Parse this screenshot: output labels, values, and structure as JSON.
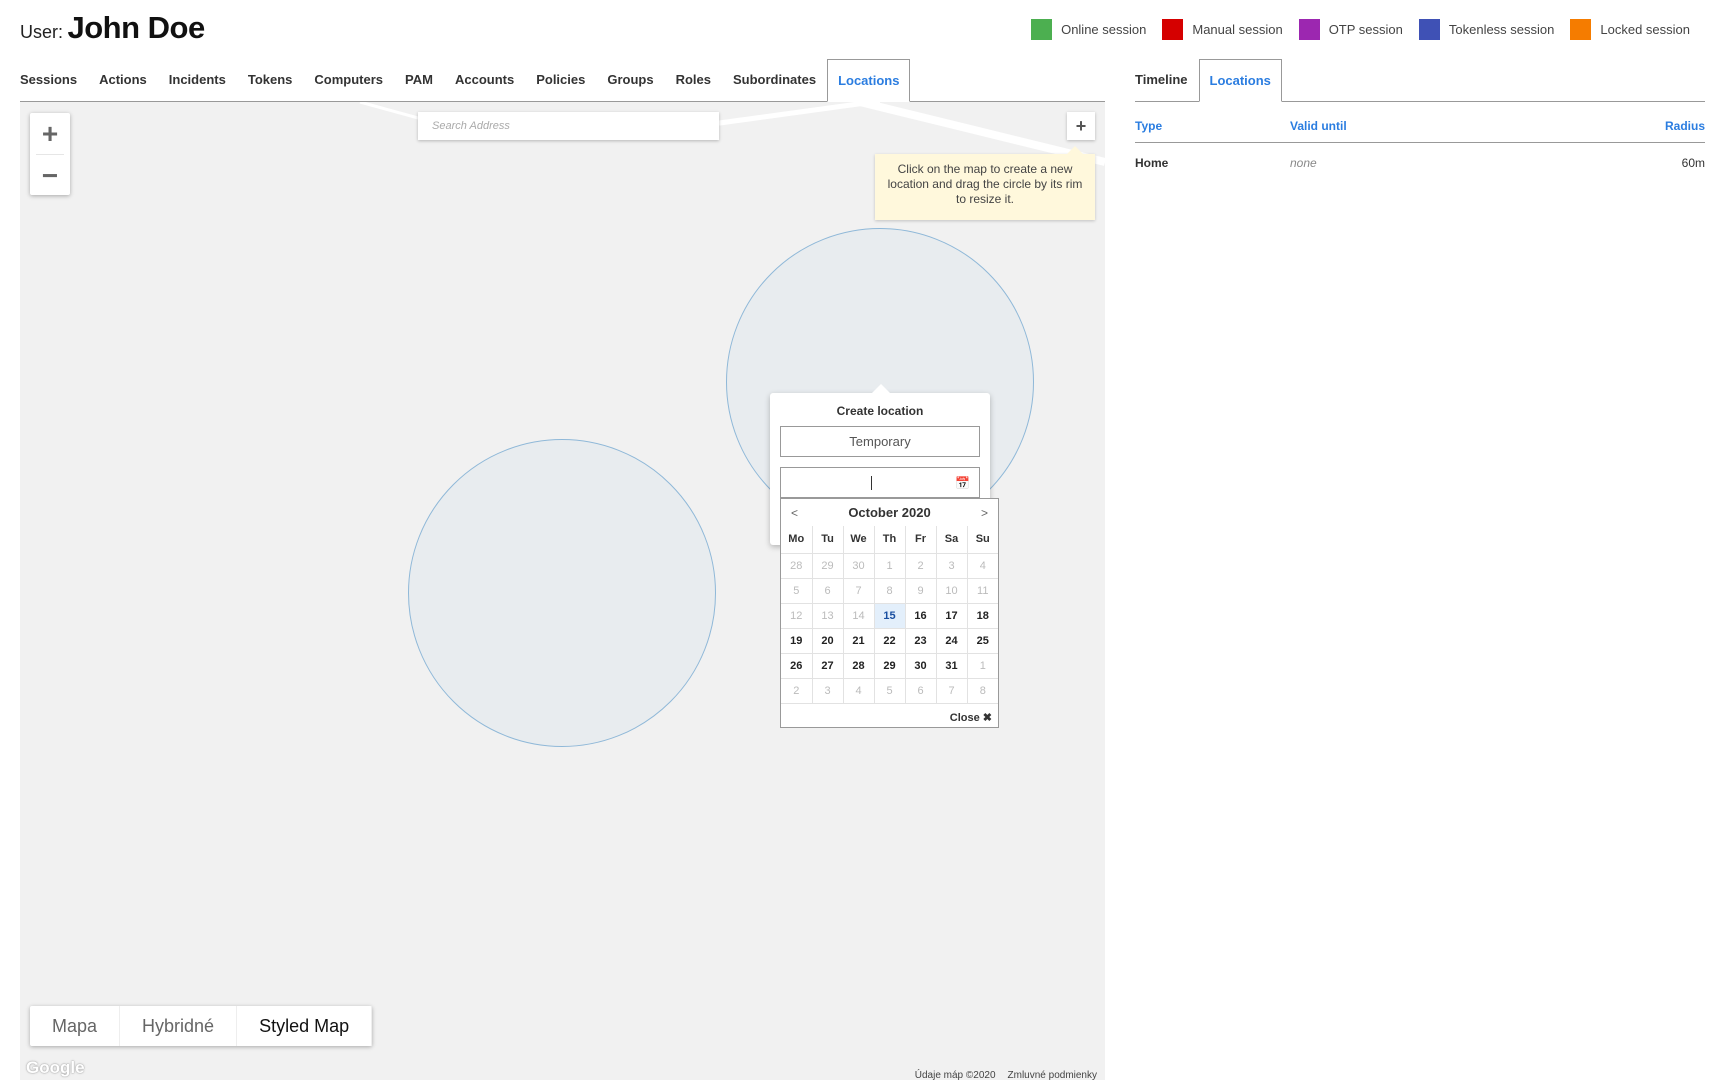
{
  "header": {
    "user_label": "User:",
    "user_name": "John Doe"
  },
  "legend": [
    {
      "label": "Online session",
      "color": "#4caf50"
    },
    {
      "label": "Manual session",
      "color": "#d50000"
    },
    {
      "label": "OTP session",
      "color": "#9c27b0"
    },
    {
      "label": "Tokenless session",
      "color": "#3f51b5"
    },
    {
      "label": "Locked session",
      "color": "#f57c00"
    }
  ],
  "main_tabs": [
    "Sessions",
    "Actions",
    "Incidents",
    "Tokens",
    "Computers",
    "PAM",
    "Accounts",
    "Policies",
    "Groups",
    "Roles",
    "Subordinates",
    "Locations"
  ],
  "main_active": "Locations",
  "map": {
    "search_placeholder": "Search Address",
    "zoom_in": "+",
    "zoom_out": "−",
    "add_button": "+",
    "tooltip": "Click on the map to create a new location and drag the circle by its rim to resize it.",
    "map_types": [
      "Mapa",
      "Hybridné",
      "Styled Map"
    ],
    "map_type_selected": "Styled Map",
    "logo": "Google",
    "footer_data": "Údaje máp ©2020",
    "footer_terms": "Zmluvné podmienky"
  },
  "popup": {
    "title": "Create location",
    "type_value": "Temporary",
    "date_value": ""
  },
  "calendar": {
    "month": "October 2020",
    "prev": "<",
    "next": ">",
    "close": "Close ✖",
    "day_names": [
      "Mo",
      "Tu",
      "We",
      "Th",
      "Fr",
      "Sa",
      "Su"
    ],
    "weeks": [
      [
        [
          "28",
          1
        ],
        [
          "29",
          1
        ],
        [
          "30",
          1
        ],
        [
          "1",
          1
        ],
        [
          "2",
          1
        ],
        [
          "3",
          1
        ],
        [
          "4",
          1
        ]
      ],
      [
        [
          "5",
          1
        ],
        [
          "6",
          1
        ],
        [
          "7",
          1
        ],
        [
          "8",
          1
        ],
        [
          "9",
          1
        ],
        [
          "10",
          1
        ],
        [
          "11",
          1
        ]
      ],
      [
        [
          "12",
          1
        ],
        [
          "13",
          1
        ],
        [
          "14",
          1
        ],
        [
          "15",
          2
        ],
        [
          "16",
          0
        ],
        [
          "17",
          0
        ],
        [
          "18",
          0
        ]
      ],
      [
        [
          "19",
          0
        ],
        [
          "20",
          0
        ],
        [
          "21",
          0
        ],
        [
          "22",
          0
        ],
        [
          "23",
          0
        ],
        [
          "24",
          0
        ],
        [
          "25",
          0
        ]
      ],
      [
        [
          "26",
          0
        ],
        [
          "27",
          0
        ],
        [
          "28",
          0
        ],
        [
          "29",
          0
        ],
        [
          "30",
          0
        ],
        [
          "31",
          0
        ],
        [
          "1",
          1
        ]
      ],
      [
        [
          "2",
          1
        ],
        [
          "3",
          1
        ],
        [
          "4",
          1
        ],
        [
          "5",
          1
        ],
        [
          "6",
          1
        ],
        [
          "7",
          1
        ],
        [
          "8",
          1
        ]
      ]
    ]
  },
  "side_tabs": [
    "Timeline",
    "Locations"
  ],
  "side_active": "Locations",
  "locations_table": {
    "headers": [
      "Type",
      "Valid until",
      "Radius"
    ],
    "rows": [
      [
        "Home",
        "none",
        "60m"
      ]
    ]
  }
}
